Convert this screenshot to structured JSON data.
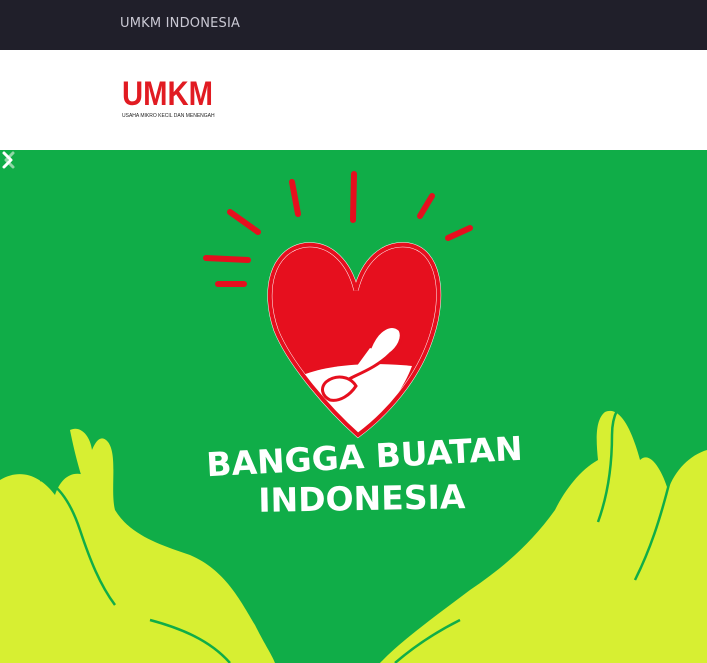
{
  "topbar": {
    "site_name": "UMKM INDONESIA"
  },
  "logo": {
    "word": "UMKM",
    "tagline": "USAHA MIKRO KECIL DAN MENENGAH",
    "color": "#e11b22"
  },
  "hero": {
    "background": "#10ad48",
    "heart_color": "#e60f1e",
    "hands_color": "#d7ef32",
    "headline_line1": "BANGGA BUATAN",
    "headline_line2": "INDONESIA",
    "prev_icon": "chevron-left-icon",
    "next_icon": "chevron-right-icon"
  }
}
